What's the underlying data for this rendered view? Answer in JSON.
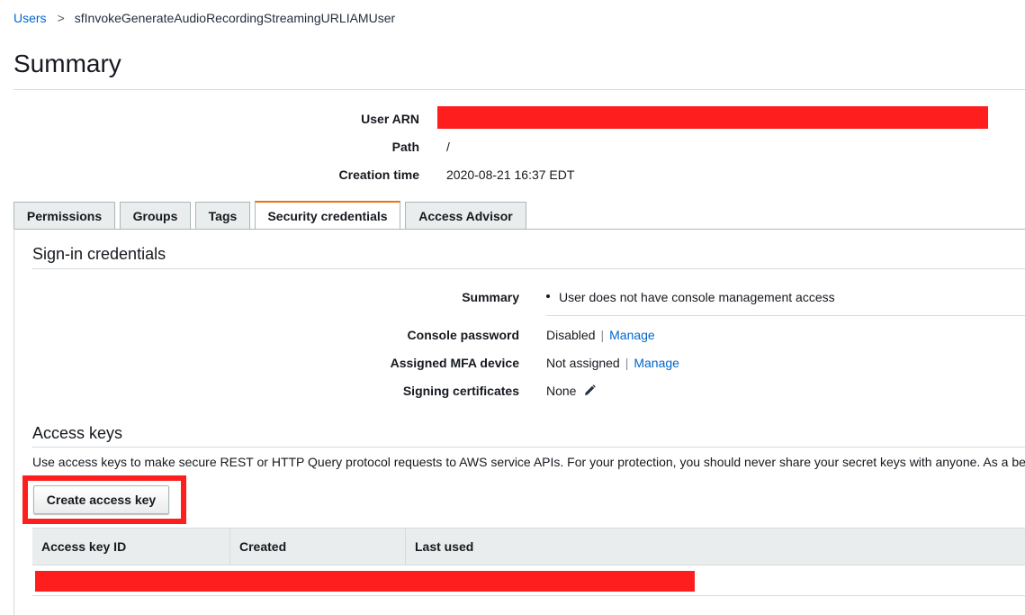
{
  "breadcrumb": {
    "parent": "Users",
    "separator": ">",
    "current": "sfInvokeGenerateAudioRecordingStreamingURLIAMUser"
  },
  "page_title": "Summary",
  "summary": {
    "user_arn_label": "User ARN",
    "path_label": "Path",
    "path_value": "/",
    "creation_time_label": "Creation time",
    "creation_time_value": "2020-08-21 16:37 EDT"
  },
  "tabs": [
    {
      "label": "Permissions"
    },
    {
      "label": "Groups"
    },
    {
      "label": "Tags"
    },
    {
      "label": "Security credentials"
    },
    {
      "label": "Access Advisor"
    }
  ],
  "active_tab": "Security credentials",
  "signin": {
    "title": "Sign-in credentials",
    "summary_label": "Summary",
    "summary_value": "User does not have console management access",
    "console_password_label": "Console password",
    "console_password_value": "Disabled",
    "mfa_label": "Assigned MFA device",
    "mfa_value": "Not assigned",
    "manage_label": "Manage",
    "signing_certs_label": "Signing certificates",
    "signing_certs_value": "None",
    "separator": "|"
  },
  "access_keys": {
    "title": "Access keys",
    "description": "Use access keys to make secure REST or HTTP Query protocol requests to AWS service APIs. For your protection, you should never share your secret keys with anyone. As a be",
    "create_button": "Create access key",
    "columns": [
      "Access key ID",
      "Created",
      "Last used"
    ]
  },
  "icons": {
    "edit": "pencil-icon"
  },
  "colors": {
    "link": "#0066cc",
    "active_tab_accent": "#ec7211",
    "redaction": "#ff1e1e"
  }
}
